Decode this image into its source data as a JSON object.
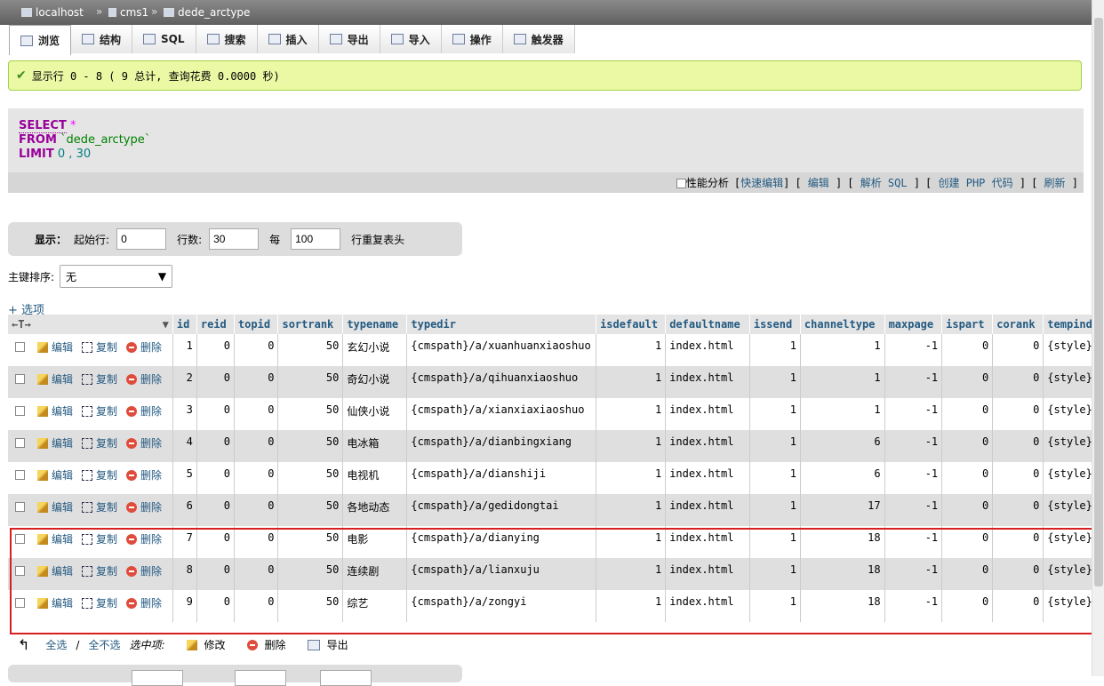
{
  "breadcrumb": {
    "server": "localhost",
    "database": "cms1",
    "table": "dede_arctype",
    "separator": "»"
  },
  "tabs": [
    {
      "label": "浏览",
      "icon": "browse-icon"
    },
    {
      "label": "结构",
      "icon": "structure-icon"
    },
    {
      "label": "SQL",
      "icon": "sql-icon"
    },
    {
      "label": "搜索",
      "icon": "search-icon"
    },
    {
      "label": "插入",
      "icon": "insert-icon"
    },
    {
      "label": "导出",
      "icon": "export-icon"
    },
    {
      "label": "导入",
      "icon": "import-icon"
    },
    {
      "label": "操作",
      "icon": "wrench-icon"
    },
    {
      "label": "触发器",
      "icon": "triggers-icon"
    }
  ],
  "success_message": "显示行 0 - 8 ( 9 总计, 查询花费 0.0000 秒)",
  "sql": {
    "select": "SELECT",
    "star": "*",
    "from": "FROM",
    "table": "`dede_arctype`",
    "limit": "LIMIT",
    "limit_args": "0 , 30"
  },
  "sql_actions": {
    "profiling": "性能分析",
    "inline_edit": "快速编辑",
    "edit": "编辑",
    "explain": "解析 SQL",
    "create_php": "创建 PHP 代码",
    "refresh": "刷新"
  },
  "navigation": {
    "show_label": "显示：",
    "start_label": "起始行:",
    "start_value": "0",
    "rows_label": "行数:",
    "rows_value": "30",
    "per_label": "每",
    "per_value": "100",
    "repeat_label": "行重复表头"
  },
  "sort": {
    "label": "主键排序:",
    "value": "无"
  },
  "options_link": "+ 选项",
  "columns": [
    "id",
    "reid",
    "topid",
    "sortrank",
    "typename",
    "typedir",
    "isdefault",
    "defaultname",
    "issend",
    "channeltype",
    "maxpage",
    "ispart",
    "corank",
    "tempind"
  ],
  "row_actions": {
    "edit": "编辑",
    "copy": "复制",
    "delete": "删除"
  },
  "rows": [
    [
      "1",
      "0",
      "0",
      "50",
      "玄幻小说",
      "{cmspath}/a/xuanhuanxiaoshuo",
      "1",
      "index.html",
      "1",
      "1",
      "-1",
      "0",
      "0",
      "{style}/"
    ],
    [
      "2",
      "0",
      "0",
      "50",
      "奇幻小说",
      "{cmspath}/a/qihuanxiaoshuo",
      "1",
      "index.html",
      "1",
      "1",
      "-1",
      "0",
      "0",
      "{style}/"
    ],
    [
      "3",
      "0",
      "0",
      "50",
      "仙侠小说",
      "{cmspath}/a/xianxiaxiaoshuo",
      "1",
      "index.html",
      "1",
      "1",
      "-1",
      "0",
      "0",
      "{style}/"
    ],
    [
      "4",
      "0",
      "0",
      "50",
      "电冰箱",
      "{cmspath}/a/dianbingxiang",
      "1",
      "index.html",
      "1",
      "6",
      "-1",
      "0",
      "0",
      "{style}/"
    ],
    [
      "5",
      "0",
      "0",
      "50",
      "电视机",
      "{cmspath}/a/dianshiji",
      "1",
      "index.html",
      "1",
      "6",
      "-1",
      "0",
      "0",
      "{style}/"
    ],
    [
      "6",
      "0",
      "0",
      "50",
      "各地动态",
      "{cmspath}/a/gedidongtai",
      "1",
      "index.html",
      "1",
      "17",
      "-1",
      "0",
      "0",
      "{style}/"
    ],
    [
      "7",
      "0",
      "0",
      "50",
      "电影",
      "{cmspath}/a/dianying",
      "1",
      "index.html",
      "1",
      "18",
      "-1",
      "0",
      "0",
      "{style}/"
    ],
    [
      "8",
      "0",
      "0",
      "50",
      "连续剧",
      "{cmspath}/a/lianxuju",
      "1",
      "index.html",
      "1",
      "18",
      "-1",
      "0",
      "0",
      "{style}/"
    ],
    [
      "9",
      "0",
      "0",
      "50",
      "综艺",
      "{cmspath}/a/zongyi",
      "1",
      "index.html",
      "1",
      "18",
      "-1",
      "0",
      "0",
      "{style}/"
    ]
  ],
  "bulk": {
    "check_all": "全选",
    "uncheck_all": "全不选",
    "selected": "选中项:",
    "edit": "修改",
    "delete": "删除",
    "export": "导出"
  },
  "colors": {
    "link": "#235a81",
    "success_bg": "#ebf8a4",
    "highlight_border": "#d81e1e"
  }
}
